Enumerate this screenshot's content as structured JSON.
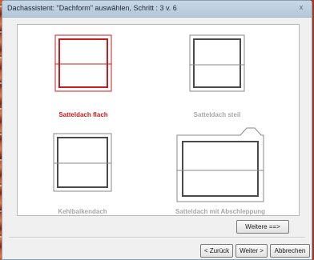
{
  "window": {
    "title": "Dachassistent: \"Dachform\" auswählen, Schritt : 3 v. 6",
    "close_glyph": "x"
  },
  "options": [
    {
      "label": "Satteldach flach",
      "selected": true,
      "icon": "roof-flat-gable-icon"
    },
    {
      "label": "Satteldach steil",
      "selected": false,
      "icon": "roof-steep-gable-icon"
    },
    {
      "label": "Kehlbalkendach",
      "selected": false,
      "icon": "collar-beam-roof-icon"
    },
    {
      "label": "Satteldach mit Abschleppung",
      "selected": false,
      "icon": "gable-roof-with-dormer-icon"
    }
  ],
  "buttons": {
    "more": "Weitere ==>",
    "back": "< Zurück",
    "next": "Weiter >",
    "cancel": "Abbrechen"
  },
  "colors": {
    "selected": "#c81c1c",
    "unselected": "#a8a8a8"
  }
}
